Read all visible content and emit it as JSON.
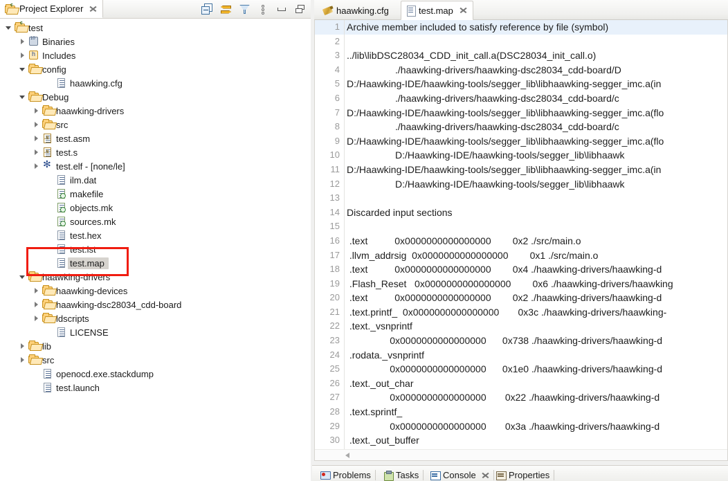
{
  "explorer": {
    "tab_title": "Project Explorer",
    "toolbar": [
      {
        "name": "collapse-all-icon"
      },
      {
        "name": "link-with-editor-icon"
      },
      {
        "name": "filter-icon"
      },
      {
        "name": "view-menu-icon"
      },
      {
        "name": "minimize-icon"
      },
      {
        "name": "maximize-icon"
      }
    ],
    "tree": [
      {
        "label": "test",
        "indent": 0,
        "state": "open",
        "icon": "project-folder-icon"
      },
      {
        "label": "Binaries",
        "indent": 1,
        "state": "closed",
        "icon": "binaries-icon"
      },
      {
        "label": "Includes",
        "indent": 1,
        "state": "closed",
        "icon": "includes-icon"
      },
      {
        "label": "config",
        "indent": 1,
        "state": "open",
        "icon": "folder-icon"
      },
      {
        "label": "haawking.cfg",
        "indent": 3,
        "state": "leaf",
        "icon": "file-icon"
      },
      {
        "label": "Debug",
        "indent": 1,
        "state": "open",
        "icon": "folder-icon"
      },
      {
        "label": "haawking-drivers",
        "indent": 2,
        "state": "closed",
        "icon": "folder-icon"
      },
      {
        "label": "src",
        "indent": 2,
        "state": "closed",
        "icon": "folder-icon"
      },
      {
        "label": "test.asm",
        "indent": 2,
        "state": "closed",
        "icon": "asm-file-icon"
      },
      {
        "label": "test.s",
        "indent": 2,
        "state": "closed",
        "icon": "asm-file-icon"
      },
      {
        "label": "test.elf - [none/le]",
        "indent": 2,
        "state": "closed",
        "icon": "elf-icon"
      },
      {
        "label": "ilm.dat",
        "indent": 3,
        "state": "leaf",
        "icon": "file-icon"
      },
      {
        "label": "makefile",
        "indent": 3,
        "state": "leaf",
        "icon": "makefile-icon"
      },
      {
        "label": "objects.mk",
        "indent": 3,
        "state": "leaf",
        "icon": "makefile-icon"
      },
      {
        "label": "sources.mk",
        "indent": 3,
        "state": "leaf",
        "icon": "makefile-icon"
      },
      {
        "label": "test.hex",
        "indent": 3,
        "state": "leaf",
        "icon": "file-icon"
      },
      {
        "label": "test.lst",
        "indent": 3,
        "state": "leaf",
        "icon": "file-icon"
      },
      {
        "label": "test.map",
        "indent": 3,
        "state": "leaf",
        "icon": "file-icon",
        "selected": true
      },
      {
        "label": "haawking-drivers",
        "indent": 1,
        "state": "open",
        "icon": "folder-icon"
      },
      {
        "label": "haawking-devices",
        "indent": 2,
        "state": "closed",
        "icon": "folder-icon"
      },
      {
        "label": "haawking-dsc28034_cdd-board",
        "indent": 2,
        "state": "closed",
        "icon": "folder-icon"
      },
      {
        "label": "ldscripts",
        "indent": 2,
        "state": "closed",
        "icon": "folder-icon"
      },
      {
        "label": "LICENSE",
        "indent": 3,
        "state": "leaf",
        "icon": "file-icon"
      },
      {
        "label": "lib",
        "indent": 1,
        "state": "closed",
        "icon": "folder-icon"
      },
      {
        "label": "src",
        "indent": 1,
        "state": "closed",
        "icon": "folder-icon"
      },
      {
        "label": "openocd.exe.stackdump",
        "indent": 2,
        "state": "leaf",
        "icon": "file-icon"
      },
      {
        "label": "test.launch",
        "indent": 2,
        "state": "leaf",
        "icon": "file-icon"
      }
    ],
    "highlight_color": "#f01c10"
  },
  "editor": {
    "tabs": [
      {
        "label": "haawking.cfg",
        "icon": "cfg-file-icon",
        "active": false,
        "closable": false
      },
      {
        "label": "test.map",
        "icon": "map-file-icon",
        "active": true,
        "closable": true
      }
    ],
    "current_line_highlight_color": "#e8f1fb",
    "lines": [
      {
        "n": "1",
        "text": "Archive member included to satisfy reference by file (symbol)",
        "highlight": true
      },
      {
        "n": "2",
        "text": ""
      },
      {
        "n": "3",
        "text": "../lib\\libDSC28034_CDD_init_call.a(DSC28034_init_call.o)"
      },
      {
        "n": "4",
        "text": "                  ./haawking-drivers/haawking-dsc28034_cdd-board/D"
      },
      {
        "n": "5",
        "text": "D:/Haawking-IDE/haawking-tools/segger_lib\\libhaawking-segger_imc.a(in"
      },
      {
        "n": "6",
        "text": "                  ./haawking-drivers/haawking-dsc28034_cdd-board/c"
      },
      {
        "n": "7",
        "text": "D:/Haawking-IDE/haawking-tools/segger_lib\\libhaawking-segger_imc.a(flo"
      },
      {
        "n": "8",
        "text": "                  ./haawking-drivers/haawking-dsc28034_cdd-board/c"
      },
      {
        "n": "9",
        "text": "D:/Haawking-IDE/haawking-tools/segger_lib\\libhaawking-segger_imc.a(flo"
      },
      {
        "n": "10",
        "text": "                  D:/Haawking-IDE/haawking-tools/segger_lib\\libhaawk"
      },
      {
        "n": "11",
        "text": "D:/Haawking-IDE/haawking-tools/segger_lib\\libhaawking-segger_imc.a(in"
      },
      {
        "n": "12",
        "text": "                  D:/Haawking-IDE/haawking-tools/segger_lib\\libhaawk"
      },
      {
        "n": "13",
        "text": ""
      },
      {
        "n": "14",
        "text": "Discarded input sections"
      },
      {
        "n": "15",
        "text": ""
      },
      {
        "n": "16",
        "text": " .text          0x0000000000000000        0x2 ./src/main.o"
      },
      {
        "n": "17",
        "text": " .llvm_addrsig  0x0000000000000000        0x1 ./src/main.o"
      },
      {
        "n": "18",
        "text": " .text          0x0000000000000000        0x4 ./haawking-drivers/haawking-d"
      },
      {
        "n": "19",
        "text": " .Flash_Reset   0x0000000000000000        0x6 ./haawking-drivers/haawking"
      },
      {
        "n": "20",
        "text": " .text          0x0000000000000000        0x2 ./haawking-drivers/haawking-d"
      },
      {
        "n": "21",
        "text": " .text.printf_  0x0000000000000000       0x3c ./haawking-drivers/haawking-"
      },
      {
        "n": "22",
        "text": " .text._vsnprintf"
      },
      {
        "n": "23",
        "text": "                0x0000000000000000      0x738 ./haawking-drivers/haawking-d"
      },
      {
        "n": "24",
        "text": " .rodata._vsnprintf"
      },
      {
        "n": "25",
        "text": "                0x0000000000000000      0x1e0 ./haawking-drivers/haawking-d"
      },
      {
        "n": "26",
        "text": " .text._out_char"
      },
      {
        "n": "27",
        "text": "                0x0000000000000000       0x22 ./haawking-drivers/haawking-d"
      },
      {
        "n": "28",
        "text": " .text.sprintf_"
      },
      {
        "n": "29",
        "text": "                0x0000000000000000       0x3a ./haawking-drivers/haawking-d"
      },
      {
        "n": "30",
        "text": " .text._out_buffer"
      }
    ]
  },
  "bottom_views": [
    {
      "label": "Problems",
      "icon": "problems-icon",
      "active": false,
      "closable": false
    },
    {
      "label": "Tasks",
      "icon": "tasks-icon",
      "active": false,
      "closable": false
    },
    {
      "label": "Console",
      "icon": "console-icon",
      "active": true,
      "closable": true
    },
    {
      "label": "Properties",
      "icon": "properties-icon",
      "active": false,
      "closable": false
    }
  ]
}
